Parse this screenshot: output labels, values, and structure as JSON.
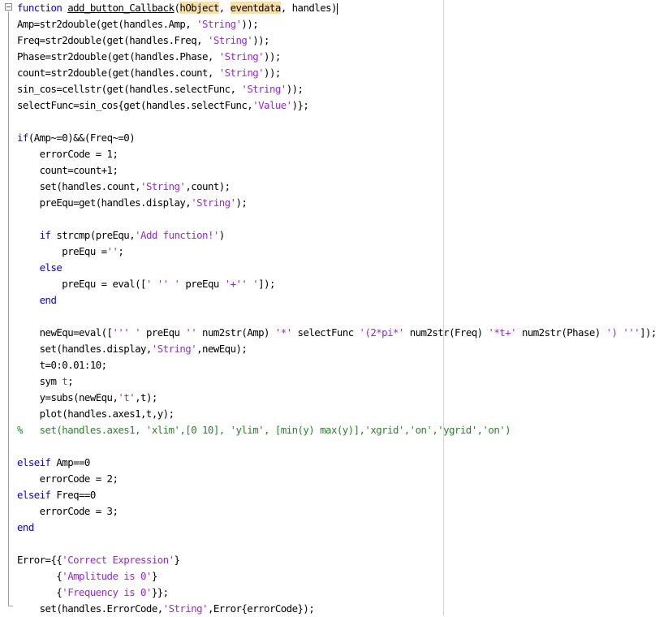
{
  "window": {
    "app": "MATLAB Editor"
  },
  "code_lines": [
    [
      {
        "t": "function",
        "c": "kw"
      },
      {
        "t": " "
      },
      {
        "t": "add_button_Callback",
        "c": "fn-name"
      },
      {
        "t": "("
      },
      {
        "t": "hObject",
        "c": "hl"
      },
      {
        "t": ", "
      },
      {
        "t": "eventdata",
        "c": "hl"
      },
      {
        "t": ", handles)"
      }
    ],
    [
      {
        "t": "Amp=str2double(get(handles.Amp, "
      },
      {
        "t": "'String'",
        "c": "str"
      },
      {
        "t": "));"
      }
    ],
    [
      {
        "t": "Freq=str2double(get(handles.Freq, "
      },
      {
        "t": "'String'",
        "c": "str"
      },
      {
        "t": "));"
      }
    ],
    [
      {
        "t": "Phase=str2double(get(handles.Phase, "
      },
      {
        "t": "'String'",
        "c": "str"
      },
      {
        "t": "));"
      }
    ],
    [
      {
        "t": "count=str2double(get(handles.count, "
      },
      {
        "t": "'String'",
        "c": "str"
      },
      {
        "t": "));"
      }
    ],
    [
      {
        "t": "sin_cos=cellstr(get(handles.selectFunc, "
      },
      {
        "t": "'String'",
        "c": "str"
      },
      {
        "t": "));"
      }
    ],
    [
      {
        "t": "selectFunc=sin_cos{get(handles.selectFunc,"
      },
      {
        "t": "'Value'",
        "c": "str"
      },
      {
        "t": ")};"
      }
    ],
    [],
    [
      {
        "t": "if",
        "c": "kw"
      },
      {
        "t": "(Amp~=0)&&(Freq~=0)"
      }
    ],
    [
      {
        "t": "    errorCode = 1;"
      }
    ],
    [
      {
        "t": "    count=count+1;"
      }
    ],
    [
      {
        "t": "    set(handles.count,"
      },
      {
        "t": "'String'",
        "c": "str"
      },
      {
        "t": ",count);"
      }
    ],
    [
      {
        "t": "    preEqu=get(handles.display,"
      },
      {
        "t": "'String'",
        "c": "str"
      },
      {
        "t": ");"
      }
    ],
    [],
    [
      {
        "t": "    "
      },
      {
        "t": "if",
        "c": "kw"
      },
      {
        "t": " strcmp(preEqu,"
      },
      {
        "t": "'Add function!'",
        "c": "str"
      },
      {
        "t": ")"
      }
    ],
    [
      {
        "t": "        preEqu ="
      },
      {
        "t": "''",
        "c": "str"
      },
      {
        "t": ";"
      }
    ],
    [
      {
        "t": "    "
      },
      {
        "t": "else",
        "c": "kw"
      }
    ],
    [
      {
        "t": "        preEqu = eval(["
      },
      {
        "t": "' '' '",
        "c": "str"
      },
      {
        "t": " preEqu "
      },
      {
        "t": "'+'' '",
        "c": "str"
      },
      {
        "t": "]);"
      }
    ],
    [
      {
        "t": "    "
      },
      {
        "t": "end",
        "c": "kw"
      }
    ],
    [],
    [
      {
        "t": "    newEqu=eval(["
      },
      {
        "t": "''' '",
        "c": "str"
      },
      {
        "t": " preEqu "
      },
      {
        "t": "''",
        "c": "str"
      },
      {
        "t": " num2str(Amp) "
      },
      {
        "t": "'*'",
        "c": "str"
      },
      {
        "t": " selectFunc "
      },
      {
        "t": "'(2*pi*'",
        "c": "str"
      },
      {
        "t": " num2str(Freq) "
      },
      {
        "t": "'*t+'",
        "c": "str"
      },
      {
        "t": " num2str(Phase) "
      },
      {
        "t": "') '''",
        "c": "str"
      },
      {
        "t": "]);"
      }
    ],
    [
      {
        "t": "    set(handles.display,"
      },
      {
        "t": "'String'",
        "c": "str"
      },
      {
        "t": ",newEqu);"
      }
    ],
    [
      {
        "t": "    t=0:0.01:10;"
      }
    ],
    [
      {
        "t": "    sym "
      },
      {
        "t": "t",
        "c": "str"
      },
      {
        "t": ";"
      }
    ],
    [
      {
        "t": "    y=subs(newEqu,"
      },
      {
        "t": "'t'",
        "c": "str"
      },
      {
        "t": ",t);"
      }
    ],
    [
      {
        "t": "    plot(handles.axes1,t,y);"
      }
    ],
    [
      {
        "t": "%   set(handles.axes1, 'xlim',[0 10], 'ylim', [min(y) max(y)],'xgrid','on','ygrid','on')",
        "c": "cm"
      }
    ],
    [],
    [
      {
        "t": "elseif",
        "c": "kw"
      },
      {
        "t": " Amp==0"
      }
    ],
    [
      {
        "t": "    errorCode = 2;"
      }
    ],
    [
      {
        "t": "elseif",
        "c": "kw"
      },
      {
        "t": " Freq==0"
      }
    ],
    [
      {
        "t": "    errorCode = 3;"
      }
    ],
    [
      {
        "t": "end",
        "c": "kw"
      }
    ],
    [],
    [
      {
        "t": "Error={{"
      },
      {
        "t": "'Correct Expression'",
        "c": "str"
      },
      {
        "t": "}"
      }
    ],
    [
      {
        "t": "       {"
      },
      {
        "t": "'Amplitude is 0'",
        "c": "str"
      },
      {
        "t": "}"
      }
    ],
    [
      {
        "t": "       {"
      },
      {
        "t": "'Frequency is 0'",
        "c": "str"
      },
      {
        "t": "}};"
      }
    ],
    [
      {
        "t": "    set(handles.ErrorCode,"
      },
      {
        "t": "'String'",
        "c": "str"
      },
      {
        "t": ",Error{errorCode});"
      }
    ]
  ]
}
